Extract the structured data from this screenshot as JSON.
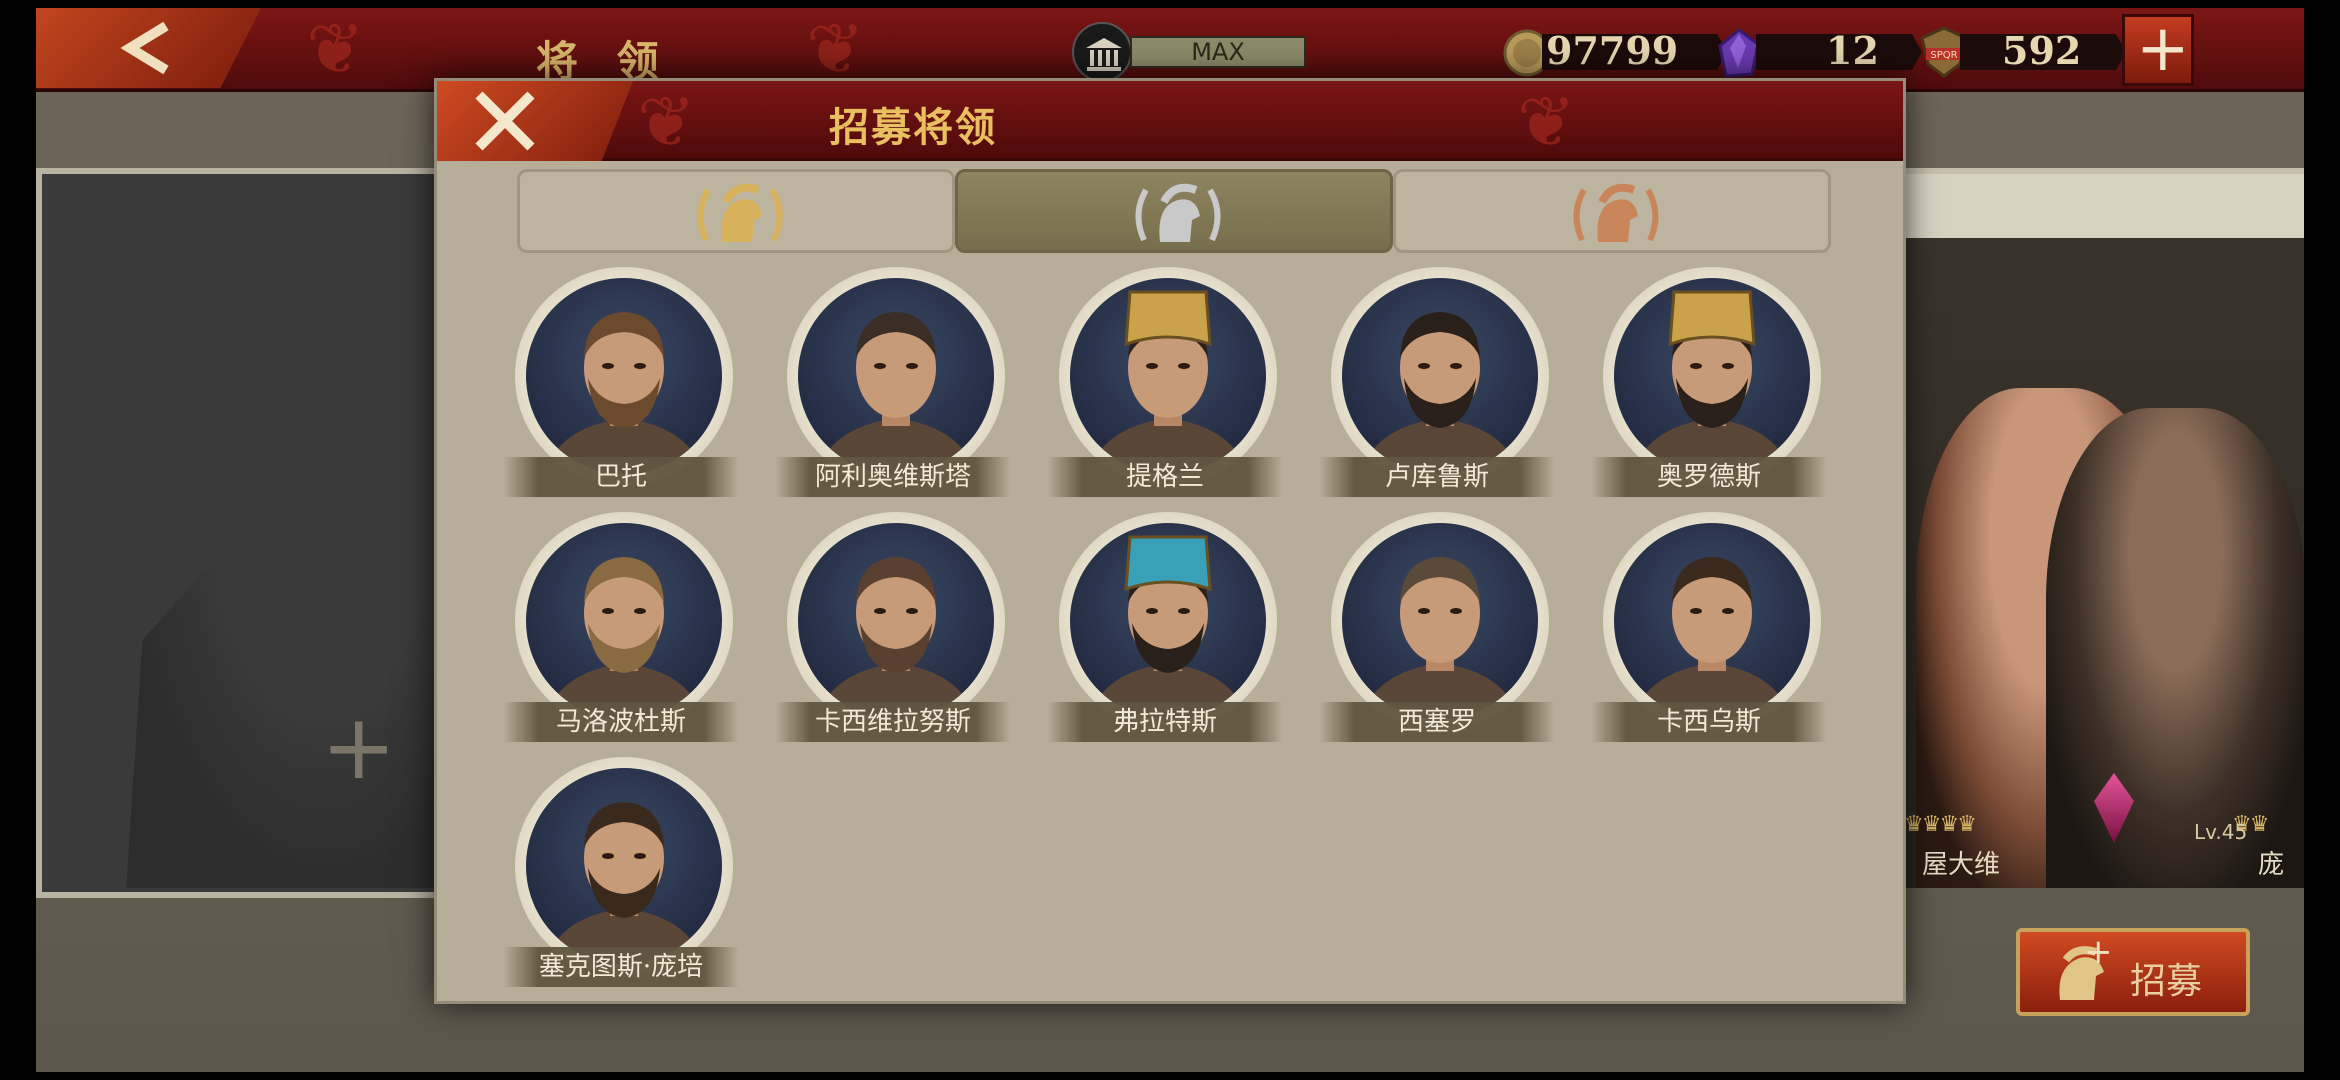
{
  "screen": {
    "title": "将 领",
    "bank_level": "MAX",
    "gold": "97799",
    "gems": "12",
    "tokens": "592",
    "tokens_icon_text": "SPQR",
    "plus_label": "+",
    "slot_plus": "+",
    "recruit_button": "招募",
    "right_heroes": [
      {
        "name": "屋大维",
        "level": ""
      },
      {
        "name": "庞",
        "level": "Lv.45"
      }
    ]
  },
  "modal": {
    "title": "招募将领",
    "tabs": [
      {
        "name": "gold-tier",
        "color": "#d8b25a",
        "active": false
      },
      {
        "name": "silver-tier",
        "color": "#c9c9c9",
        "active": true
      },
      {
        "name": "bronze-tier",
        "color": "#c9845a",
        "active": false
      }
    ],
    "heroes": [
      {
        "name": "巴托",
        "hair": "#6b4a2e",
        "beard": true,
        "hat": ""
      },
      {
        "name": "阿利奥维斯塔",
        "hair": "#3a2e26",
        "beard": false,
        "hat": ""
      },
      {
        "name": "提格兰",
        "hair": "#2c221c",
        "beard": false,
        "hat": "#c9a24a"
      },
      {
        "name": "卢库鲁斯",
        "hair": "#2a201a",
        "beard": true,
        "hat": ""
      },
      {
        "name": "奥罗德斯",
        "hair": "#2a201a",
        "beard": true,
        "hat": "#c9a24a"
      },
      {
        "name": "马洛波杜斯",
        "hair": "#8a6a40",
        "beard": true,
        "hat": ""
      },
      {
        "name": "卡西维拉努斯",
        "hair": "#5a4030",
        "beard": true,
        "hat": ""
      },
      {
        "name": "弗拉特斯",
        "hair": "#2a201a",
        "beard": true,
        "hat": "#3aa0b8"
      },
      {
        "name": "西塞罗",
        "hair": "#5a4a3a",
        "beard": false,
        "hat": ""
      },
      {
        "name": "卡西乌斯",
        "hair": "#3a2a1e",
        "beard": false,
        "hat": ""
      },
      {
        "name": "塞克图斯·庞培",
        "hair": "#3a2a1e",
        "beard": true,
        "hat": ""
      }
    ]
  }
}
